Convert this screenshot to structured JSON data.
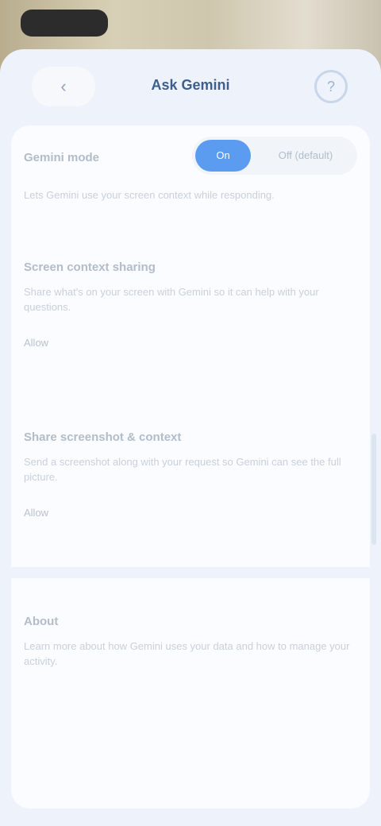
{
  "header": {
    "back_label": "‹",
    "title": "Ask Gemini",
    "action_icon": "help-icon",
    "action_label": "?"
  },
  "settings": {
    "row1": {
      "title": "Gemini mode",
      "segmented": {
        "on_label": "On",
        "off_label": "Off (default)"
      },
      "description": "Lets Gemini use your screen context while responding."
    },
    "row2": {
      "title": "Screen context sharing",
      "description": "Share what's on your screen with Gemini so it can help with your questions.",
      "value": "Allow"
    },
    "row3": {
      "title": "Share screenshot & context",
      "description": "Send a screenshot along with your request so Gemini can see the full picture.",
      "value": "Allow"
    },
    "row4": {
      "title": "About",
      "description": "Learn more about how Gemini uses your data and how to manage your activity."
    }
  },
  "colors": {
    "accent": "#5b9cf0",
    "title": "#3d5f8e",
    "background": "#eef3fb",
    "card": "#fbfcff"
  }
}
